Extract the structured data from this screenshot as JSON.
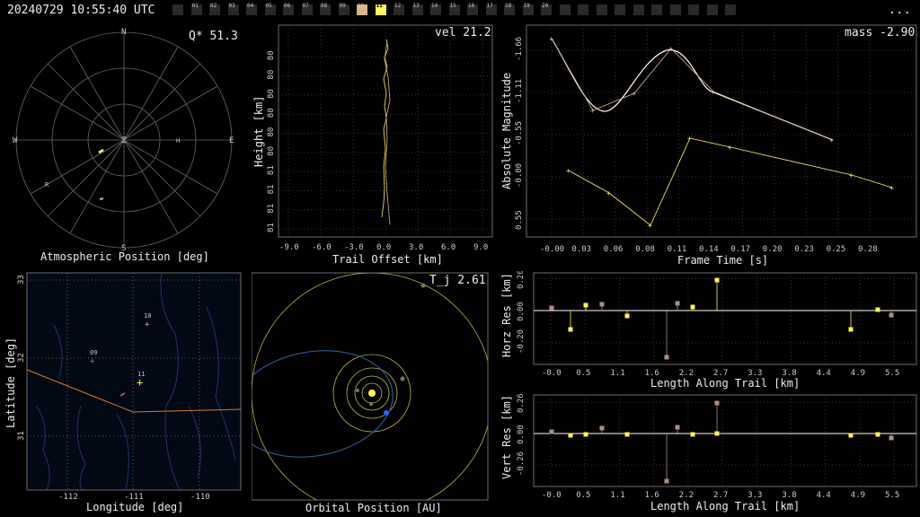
{
  "header": {
    "timestamp": "20240729 10:55:40 UTC",
    "menu": "...",
    "frames": [
      "01",
      "02",
      "03",
      "04",
      "05",
      "06",
      "07",
      "08",
      "09",
      "10",
      "11",
      "12",
      "13",
      "14",
      "15",
      "16",
      "17",
      "18",
      "19",
      "20"
    ],
    "selected_frame": "11",
    "previous_frame": "10"
  },
  "colors": {
    "accent": "#fff25a",
    "trail": "#d9b48c",
    "orbit_blue": "#2266cc"
  },
  "sky": {
    "title": "Atmospheric Position [deg]",
    "quality": "Q* 51.3",
    "dirs": {
      "n": "N",
      "s": "S",
      "e": "E",
      "w": "W",
      "z": "Z"
    },
    "marks": [
      "R",
      "H"
    ]
  },
  "height": {
    "speed": "vel 21.2",
    "xlabel": "Trail Offset [km]",
    "ylabel": "Height [km]",
    "xticks": [
      "-9.0",
      "-6.0",
      "-3.0",
      "0.0",
      "3.0",
      "6.0",
      "9.0"
    ],
    "yticks": [
      "81",
      "81",
      "81",
      "81",
      "80",
      "80",
      "80",
      "80",
      "80",
      "80"
    ]
  },
  "light": {
    "mass": "mass -2.90",
    "xlabel": "Frame Time [s]",
    "ylabel": "Absolute Magnitude",
    "xticks": [
      "-0.00",
      "0.03",
      "0.06",
      "0.08",
      "0.11",
      "0.14",
      "0.17",
      "0.20",
      "0.23",
      "0.25",
      "0.28"
    ],
    "yticks": [
      "-1.66",
      "-1.11",
      "-0.55",
      "-0.00",
      "0.55"
    ]
  },
  "map": {
    "xlabel": "Longitude [deg]",
    "ylabel": "Latitude [deg]",
    "xticks": [
      "-112",
      "-111",
      "-110"
    ],
    "yticks": [
      "33",
      "32",
      "31"
    ],
    "stations": [
      "10",
      "09",
      "11"
    ]
  },
  "orbit": {
    "tj": "T_j 2.61",
    "xlabel": "Orbital Position [AU]"
  },
  "horz": {
    "ylabel": "Horz Res [km]",
    "xlabel": "Length Along Trail [km]",
    "xticks": [
      "-0.0",
      "0.5",
      "1.1",
      "1.6",
      "2.2",
      "2.7",
      "3.3",
      "3.8",
      "4.4",
      "4.9",
      "5.5"
    ],
    "yticks": [
      "0.20",
      "0.00",
      "-0.20"
    ]
  },
  "vert": {
    "ylabel": "Vert Res [km]",
    "xlabel": "Length Along Trail [km]",
    "xticks": [
      "-0.0",
      "0.5",
      "1.1",
      "1.6",
      "2.2",
      "2.7",
      "3.3",
      "3.8",
      "4.4",
      "4.9",
      "5.5"
    ],
    "yticks": [
      "0.26",
      "0.00",
      "-0.26"
    ]
  }
}
